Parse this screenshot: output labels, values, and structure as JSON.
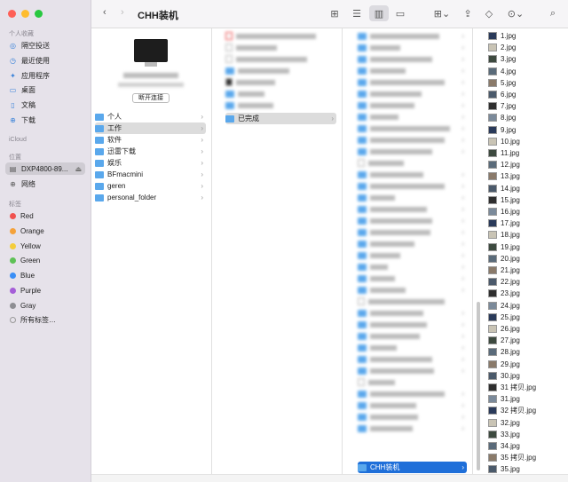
{
  "window": {
    "title": "CHH装机"
  },
  "sidebar": {
    "favorites_header": "个人收藏",
    "favorites": [
      {
        "label": "隔空投送",
        "icon": "airdrop-icon"
      },
      {
        "label": "最近使用",
        "icon": "clock-icon"
      },
      {
        "label": "应用程序",
        "icon": "apps-icon"
      },
      {
        "label": "桌面",
        "icon": "desktop-icon"
      },
      {
        "label": "文稿",
        "icon": "document-icon"
      },
      {
        "label": "下载",
        "icon": "download-icon"
      }
    ],
    "icloud_header": "iCloud",
    "locations_header": "位置",
    "locations": [
      {
        "label": "DXP4800-89...",
        "icon": "nas-icon"
      },
      {
        "label": "网络",
        "icon": "network-icon"
      }
    ],
    "tags_header": "标签",
    "tags": [
      {
        "label": "Red",
        "color": "#f0524f"
      },
      {
        "label": "Orange",
        "color": "#f5a23a"
      },
      {
        "label": "Yellow",
        "color": "#f4cd3b"
      },
      {
        "label": "Green",
        "color": "#5ec156"
      },
      {
        "label": "Blue",
        "color": "#3a8ef6"
      },
      {
        "label": "Purple",
        "color": "#a55ed8"
      },
      {
        "label": "Gray",
        "color": "#8e8e93"
      },
      {
        "label": "所有标签…",
        "color": ""
      }
    ]
  },
  "preview": {
    "connect_label": "断开连接"
  },
  "column1": [
    "个人",
    "工作",
    "软件",
    "迅雷下载",
    "娱乐",
    "BFmacmini",
    "geren",
    "personal_folder"
  ],
  "column2_selected": "已完成",
  "column3_selected": "CHH装机",
  "column4": [
    "1.jpg",
    "2.jpg",
    "3.jpg",
    "4.jpg",
    "5.jpg",
    "6.jpg",
    "7.jpg",
    "8.jpg",
    "9.jpg",
    "10.jpg",
    "11.jpg",
    "12.jpg",
    "13.jpg",
    "14.jpg",
    "15.jpg",
    "16.jpg",
    "17.jpg",
    "18.jpg",
    "19.jpg",
    "20.jpg",
    "21.jpg",
    "22.jpg",
    "23.jpg",
    "24.jpg",
    "25.jpg",
    "26.jpg",
    "27.jpg",
    "28.jpg",
    "29.jpg",
    "30.jpg",
    "31 拷贝.jpg",
    "31.jpg",
    "32 拷贝.jpg",
    "32.jpg",
    "33.jpg",
    "34.jpg",
    "35 拷贝.jpg",
    "35.jpg"
  ]
}
